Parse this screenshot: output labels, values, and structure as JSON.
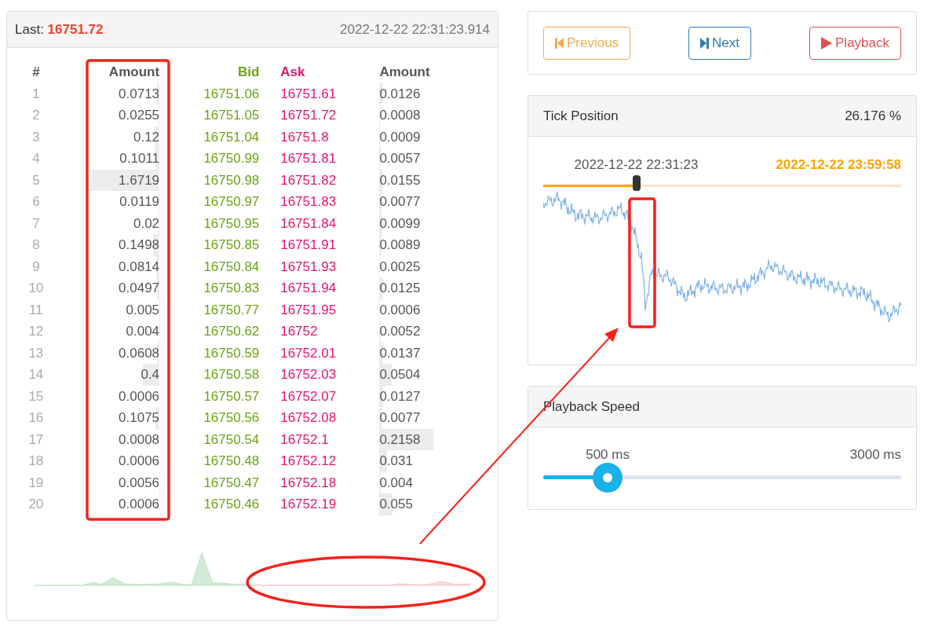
{
  "order_book": {
    "last_label": "Last:",
    "last_price": "16751.72",
    "timestamp": "2022-12-22 22:31:23.914",
    "columns": [
      "#",
      "Amount",
      "Bid",
      "Ask",
      "Amount"
    ],
    "rows": [
      {
        "index": "1",
        "bid_amount": {
          "text": "0.0713",
          "level": 0.04
        },
        "bid": "16751.06",
        "ask": "16751.61",
        "ask_amount": {
          "text": "0.0126",
          "level": 0.06
        }
      },
      {
        "index": "2",
        "bid_amount": {
          "text": "0.0255",
          "level": 0.015
        },
        "bid": "16751.05",
        "ask": "16751.72",
        "ask_amount": {
          "text": "0.0008",
          "level": 0.004
        }
      },
      {
        "index": "3",
        "bid_amount": {
          "text": "0.12",
          "level": 0.07
        },
        "bid": "16751.04",
        "ask": "16751.8",
        "ask_amount": {
          "text": "0.0009",
          "level": 0.004
        }
      },
      {
        "index": "4",
        "bid_amount": {
          "text": "0.1011",
          "level": 0.06
        },
        "bid": "16750.99",
        "ask": "16751.81",
        "ask_amount": {
          "text": "0.0057",
          "level": 0.03
        }
      },
      {
        "index": "5",
        "bid_amount": {
          "text": "1.6719",
          "level": 1
        },
        "bid": "16750.98",
        "ask": "16751.82",
        "ask_amount": {
          "text": "0.0155",
          "level": 0.07
        }
      },
      {
        "index": "6",
        "bid_amount": {
          "text": "0.0119",
          "level": 0.01
        },
        "bid": "16750.97",
        "ask": "16751.83",
        "ask_amount": {
          "text": "0.0077",
          "level": 0.04
        }
      },
      {
        "index": "7",
        "bid_amount": {
          "text": "0.02",
          "level": 0.012
        },
        "bid": "16750.95",
        "ask": "16751.84",
        "ask_amount": {
          "text": "0.0099",
          "level": 0.05
        }
      },
      {
        "index": "8",
        "bid_amount": {
          "text": "0.1498",
          "level": 0.09
        },
        "bid": "16750.85",
        "ask": "16751.91",
        "ask_amount": {
          "text": "0.0089",
          "level": 0.04
        }
      },
      {
        "index": "9",
        "bid_amount": {
          "text": "0.0814",
          "level": 0.05
        },
        "bid": "16750.84",
        "ask": "16751.93",
        "ask_amount": {
          "text": "0.0025",
          "level": 0.012
        }
      },
      {
        "index": "10",
        "bid_amount": {
          "text": "0.0497",
          "level": 0.03
        },
        "bid": "16750.83",
        "ask": "16751.94",
        "ask_amount": {
          "text": "0.0125",
          "level": 0.06
        }
      },
      {
        "index": "11",
        "bid_amount": {
          "text": "0.005",
          "level": 0.003
        },
        "bid": "16750.77",
        "ask": "16751.95",
        "ask_amount": {
          "text": "0.0006",
          "level": 0.003
        }
      },
      {
        "index": "12",
        "bid_amount": {
          "text": "0.004",
          "level": 0.002
        },
        "bid": "16750.62",
        "ask": "16752",
        "ask_amount": {
          "text": "0.0052",
          "level": 0.024
        }
      },
      {
        "index": "13",
        "bid_amount": {
          "text": "0.0608",
          "level": 0.04
        },
        "bid": "16750.59",
        "ask": "16752.01",
        "ask_amount": {
          "text": "0.0137",
          "level": 0.063
        }
      },
      {
        "index": "14",
        "bid_amount": {
          "text": "0.4",
          "level": 0.24
        },
        "bid": "16750.58",
        "ask": "16752.03",
        "ask_amount": {
          "text": "0.0504",
          "level": 0.23
        }
      },
      {
        "index": "15",
        "bid_amount": {
          "text": "0.0006",
          "level": 0.0004
        },
        "bid": "16750.57",
        "ask": "16752.07",
        "ask_amount": {
          "text": "0.0127",
          "level": 0.06
        }
      },
      {
        "index": "16",
        "bid_amount": {
          "text": "0.1075",
          "level": 0.064
        },
        "bid": "16750.56",
        "ask": "16752.08",
        "ask_amount": {
          "text": "0.0077",
          "level": 0.036
        }
      },
      {
        "index": "17",
        "bid_amount": {
          "text": "0.0008",
          "level": 0.0005
        },
        "bid": "16750.54",
        "ask": "16752.1",
        "ask_amount": {
          "text": "0.2158",
          "level": 1
        }
      },
      {
        "index": "18",
        "bid_amount": {
          "text": "0.0006",
          "level": 0.0004
        },
        "bid": "16750.48",
        "ask": "16752.12",
        "ask_amount": {
          "text": "0.031",
          "level": 0.14
        }
      },
      {
        "index": "19",
        "bid_amount": {
          "text": "0.0056",
          "level": 0.003
        },
        "bid": "16750.47",
        "ask": "16752.18",
        "ask_amount": {
          "text": "0.004",
          "level": 0.02
        }
      },
      {
        "index": "20",
        "bid_amount": {
          "text": "0.0006",
          "level": 0.0004
        },
        "bid": "16750.46",
        "ask": "16752.19",
        "ask_amount": {
          "text": "0.055",
          "level": 0.25
        }
      }
    ]
  },
  "controls": [
    {
      "kind": "previous",
      "label": "Previous"
    },
    {
      "kind": "next",
      "label": "Next"
    },
    {
      "kind": "playback",
      "label": "Playback"
    }
  ],
  "tick_position": {
    "title": "Tick Position",
    "percent": "26.176 %",
    "current_time": "2022-12-22 22:31:23",
    "end_time": "2022-12-22 23:59:58",
    "level": 0.26
  },
  "playback_speed": {
    "title": "Playback Speed",
    "current": "500 ms",
    "max": "3000 ms",
    "level": 0.18
  },
  "annotations": [
    {
      "kind": "box"
    },
    {
      "kind": "box"
    },
    {
      "kind": "ellipse"
    },
    {
      "kind": "arrow"
    }
  ]
}
